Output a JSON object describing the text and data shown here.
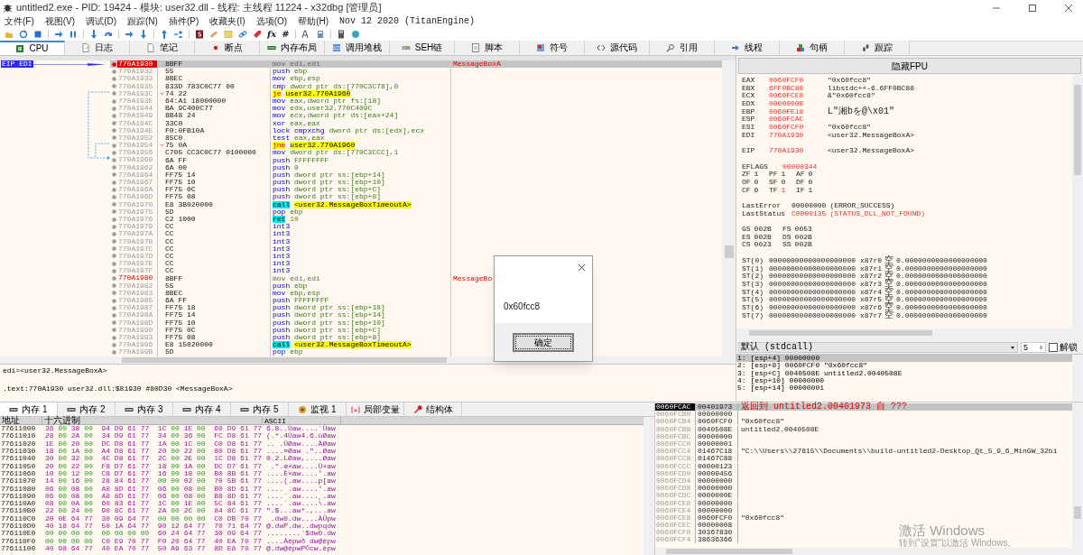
{
  "window": {
    "title": "untitled2.exe - PID: 19424 - 模块: user32.dll - 线程: 主线程 11224 - x32dbg [管理员]"
  },
  "menu": [
    "文件(F)",
    "视图(V)",
    "调试(D)",
    "跟踪(N)",
    "插件(P)",
    "收藏夹(I)",
    "选项(O)",
    "帮助(H)"
  ],
  "build_info": "Nov 12 2020 (TitanEngine)",
  "toolbar_texts": [
    "fx",
    "#"
  ],
  "tabs": [
    {
      "label": "CPU",
      "selected": true
    },
    {
      "label": "日志",
      "selected": false
    },
    {
      "label": "笔记",
      "selected": false
    },
    {
      "label": "断点",
      "selected": false
    },
    {
      "label": "内存布局",
      "selected": false
    },
    {
      "label": "调用堆栈",
      "selected": false
    },
    {
      "label": "SEH链",
      "selected": false
    },
    {
      "label": "脚本",
      "selected": false
    },
    {
      "label": "符号",
      "selected": false
    },
    {
      "label": "源代码",
      "selected": false
    },
    {
      "label": "引用",
      "selected": false
    },
    {
      "label": "线程",
      "selected": false
    },
    {
      "label": "句柄",
      "selected": false
    },
    {
      "label": "跟踪",
      "selected": false
    }
  ],
  "disassembly": {
    "pointer_label": "EIP EDI",
    "rows": [
      {
        "address": "770A1930",
        "bytes": "8BFF",
        "mnemonic": "mov",
        "operands": "edi,edi",
        "comment": "MessageBoxA",
        "eip": true,
        "symbol": true,
        "kind": "nop",
        "branch": false,
        "selected": true
      },
      {
        "address": "770A1932",
        "bytes": "55",
        "mnemonic": "push",
        "operands": "ebp",
        "eip": false,
        "symbol": false,
        "kind": "plain",
        "branch": false,
        "selected": false
      },
      {
        "address": "770A1933",
        "bytes": "8BEC",
        "mnemonic": "mov",
        "operands": "ebp,esp",
        "eip": false,
        "symbol": false,
        "kind": "plain",
        "branch": false,
        "selected": false
      },
      {
        "address": "770A1935",
        "bytes": "833D 783C0C77 00",
        "mnemonic": "cmp",
        "operands": "dword ptr ds:[770C3C78],0",
        "eip": false,
        "symbol": false,
        "kind": "plain",
        "branch": false,
        "selected": false
      },
      {
        "address": "770A193C",
        "bytes": "74 22",
        "mnemonic": "je",
        "operands": "user32.770A1960",
        "eip": false,
        "symbol": false,
        "kind": "jump",
        "branch": true,
        "selected": false
      },
      {
        "address": "770A193E",
        "bytes": "64:A1 18000000",
        "mnemonic": "mov",
        "operands": "eax,dword ptr fs:[18]",
        "eip": false,
        "symbol": false,
        "kind": "plain",
        "branch": false,
        "selected": false
      },
      {
        "address": "770A1944",
        "bytes": "BA 9C400C77",
        "mnemonic": "mov",
        "operands": "edx,user32.770C409C",
        "eip": false,
        "symbol": false,
        "kind": "plain",
        "branch": false,
        "selected": false
      },
      {
        "address": "770A1949",
        "bytes": "8B48 24",
        "mnemonic": "mov",
        "operands": "ecx,dword ptr ds:[eax+24]",
        "eip": false,
        "symbol": false,
        "kind": "plain",
        "branch": false,
        "selected": false
      },
      {
        "address": "770A194C",
        "bytes": "33C0",
        "mnemonic": "xor",
        "operands": "eax,eax",
        "eip": false,
        "symbol": false,
        "kind": "plain",
        "branch": false,
        "selected": false
      },
      {
        "address": "770A194E",
        "bytes": "F0:0FB10A",
        "mnemonic": "lock cmpxchg",
        "operands": "dword ptr ds:[edx],ecx",
        "eip": false,
        "symbol": false,
        "kind": "plain",
        "branch": false,
        "selected": false
      },
      {
        "address": "770A1952",
        "bytes": "85C0",
        "mnemonic": "test",
        "operands": "eax,eax",
        "eip": false,
        "symbol": false,
        "kind": "plain",
        "branch": false,
        "selected": false
      },
      {
        "address": "770A1954",
        "bytes": "75 0A",
        "mnemonic": "jne",
        "operands": "user32.770A1960",
        "eip": false,
        "symbol": false,
        "kind": "jump",
        "branch": true,
        "selected": false
      },
      {
        "address": "770A1956",
        "bytes": "C705 CC3C0C77 0100000",
        "mnemonic": "mov",
        "operands": "dword ptr ds:[770C3CCC],1",
        "eip": false,
        "symbol": false,
        "kind": "plain",
        "branch": false,
        "selected": false
      },
      {
        "address": "770A1960",
        "bytes": "6A FF",
        "mnemonic": "push",
        "operands": "FFFFFFFF",
        "eip": false,
        "symbol": false,
        "kind": "plain",
        "branch": false,
        "selected": false
      },
      {
        "address": "770A1962",
        "bytes": "6A 00",
        "mnemonic": "push",
        "operands": "0",
        "eip": false,
        "symbol": false,
        "kind": "plain",
        "branch": false,
        "selected": false
      },
      {
        "address": "770A1964",
        "bytes": "FF75 14",
        "mnemonic": "push",
        "operands": "dword ptr ss:[ebp+14]",
        "eip": false,
        "symbol": false,
        "kind": "plain",
        "branch": false,
        "selected": false
      },
      {
        "address": "770A1967",
        "bytes": "FF75 10",
        "mnemonic": "push",
        "operands": "dword ptr ss:[ebp+10]",
        "eip": false,
        "symbol": false,
        "kind": "plain",
        "branch": false,
        "selected": false
      },
      {
        "address": "770A196A",
        "bytes": "FF75 0C",
        "mnemonic": "push",
        "operands": "dword ptr ss:[ebp+C]",
        "eip": false,
        "symbol": false,
        "kind": "plain",
        "branch": false,
        "selected": false
      },
      {
        "address": "770A196D",
        "bytes": "FF75 08",
        "mnemonic": "push",
        "operands": "dword ptr ss:[ebp+8]",
        "eip": false,
        "symbol": false,
        "kind": "plain",
        "branch": false,
        "selected": false
      },
      {
        "address": "770A1970",
        "bytes": "E8 3B020000",
        "mnemonic": "call",
        "operands": "<user32.MessageBoxTimeoutA>",
        "eip": false,
        "symbol": false,
        "kind": "call",
        "branch": false,
        "selected": false
      },
      {
        "address": "770A1975",
        "bytes": "5D",
        "mnemonic": "pop",
        "operands": "ebp",
        "eip": false,
        "symbol": false,
        "kind": "plain",
        "branch": false,
        "selected": false
      },
      {
        "address": "770A1976",
        "bytes": "C2 1000",
        "mnemonic": "ret",
        "operands": "10",
        "eip": false,
        "symbol": false,
        "kind": "ret",
        "branch": false,
        "selected": false
      },
      {
        "address": "770A1979",
        "bytes": "CC",
        "mnemonic": "int3",
        "eip": false,
        "symbol": false,
        "kind": "plain",
        "branch": false,
        "selected": false
      },
      {
        "address": "770A197A",
        "bytes": "CC",
        "mnemonic": "int3",
        "eip": false,
        "symbol": false,
        "kind": "plain",
        "branch": false,
        "selected": false
      },
      {
        "address": "770A197B",
        "bytes": "CC",
        "mnemonic": "int3",
        "eip": false,
        "symbol": false,
        "kind": "plain",
        "branch": false,
        "selected": false
      },
      {
        "address": "770A197C",
        "bytes": "CC",
        "mnemonic": "int3",
        "eip": false,
        "symbol": false,
        "kind": "plain",
        "branch": false,
        "selected": false
      },
      {
        "address": "770A197D",
        "bytes": "CC",
        "mnemonic": "int3",
        "eip": false,
        "symbol": false,
        "kind": "plain",
        "branch": false,
        "selected": false
      },
      {
        "address": "770A197E",
        "bytes": "CC",
        "mnemonic": "int3",
        "eip": false,
        "symbol": false,
        "kind": "plain",
        "branch": false,
        "selected": false
      },
      {
        "address": "770A197F",
        "bytes": "CC",
        "mnemonic": "int3",
        "eip": false,
        "symbol": false,
        "kind": "plain",
        "branch": false,
        "selected": false
      },
      {
        "address": "770A1980",
        "bytes": "8BFF",
        "mnemonic": "mov",
        "operands": "edi,edi",
        "comment": "MessageBo",
        "eip": false,
        "symbol": true,
        "kind": "nop",
        "branch": false,
        "selected": false
      },
      {
        "address": "770A1982",
        "bytes": "55",
        "mnemonic": "push",
        "operands": "ebp",
        "eip": false,
        "symbol": false,
        "kind": "plain",
        "branch": false,
        "selected": false
      },
      {
        "address": "770A1983",
        "bytes": "8BEC",
        "mnemonic": "mov",
        "operands": "ebp,esp",
        "eip": false,
        "symbol": false,
        "kind": "plain",
        "branch": false,
        "selected": false
      },
      {
        "address": "770A1985",
        "bytes": "6A FF",
        "mnemonic": "push",
        "operands": "FFFFFFFF",
        "eip": false,
        "symbol": false,
        "kind": "plain",
        "branch": false,
        "selected": false
      },
      {
        "address": "770A1987",
        "bytes": "FF75 18",
        "mnemonic": "push",
        "operands": "dword ptr ss:[ebp+18]",
        "eip": false,
        "symbol": false,
        "kind": "plain",
        "branch": false,
        "selected": false
      },
      {
        "address": "770A198A",
        "bytes": "FF75 14",
        "mnemonic": "push",
        "operands": "dword ptr ss:[ebp+14]",
        "eip": false,
        "symbol": false,
        "kind": "plain",
        "branch": false,
        "selected": false
      },
      {
        "address": "770A198D",
        "bytes": "FF75 10",
        "mnemonic": "push",
        "operands": "dword ptr ss:[ebp+10]",
        "eip": false,
        "symbol": false,
        "kind": "plain",
        "branch": false,
        "selected": false
      },
      {
        "address": "770A1990",
        "bytes": "FF75 0C",
        "mnemonic": "push",
        "operands": "dword ptr ss:[ebp+C]",
        "eip": false,
        "symbol": false,
        "kind": "plain",
        "branch": false,
        "selected": false
      },
      {
        "address": "770A1993",
        "bytes": "FF75 08",
        "mnemonic": "push",
        "operands": "dword ptr ss:[ebp+8]",
        "eip": false,
        "symbol": false,
        "kind": "plain",
        "branch": false,
        "selected": false
      },
      {
        "address": "770A1996",
        "bytes": "E8 15020000",
        "mnemonic": "call",
        "operands": "<user32.MessageBoxTimeoutA>",
        "eip": false,
        "symbol": false,
        "kind": "call",
        "branch": false,
        "selected": false
      },
      {
        "address": "770A199B",
        "bytes": "5D",
        "mnemonic": "pop",
        "operands": "ebp",
        "eip": false,
        "symbol": false,
        "kind": "plain",
        "branch": false,
        "selected": false
      }
    ]
  },
  "registers": {
    "toggle_button": "隐藏FPU",
    "general": [
      {
        "name": "EAX",
        "value": "0060FCF0",
        "comment": "\"0x60fcc8\"",
        "changed": true
      },
      {
        "name": "EBX",
        "value": "6FF0BC88",
        "comment": "libstdc++-6.6FF0BC88",
        "changed": true
      },
      {
        "name": "ECX",
        "value": "0060FCE8",
        "comment": "&\"0x60fcc8\"",
        "changed": true
      },
      {
        "name": "EDX",
        "value": "00000008",
        "changed": true
      },
      {
        "name": "EBP",
        "value": "0060FE18",
        "comment": "L\"湘bを@\\x01\"",
        "changed": true
      },
      {
        "name": "ESP",
        "value": "0060FCAC",
        "changed": true
      },
      {
        "name": "ESI",
        "value": "0060FCF0",
        "comment": "\"0x60fcc8\"",
        "changed": true
      },
      {
        "name": "EDI",
        "value": "770A1930",
        "comment": "<user32.MessageBoxA>",
        "changed": true
      }
    ],
    "eip": {
      "name": "EIP",
      "value": "770A1930",
      "comment": "<user32.MessageBoxA>",
      "changed": true
    },
    "eflags": {
      "name": "EFLAGS",
      "value": "00000344",
      "changed": true
    },
    "flags": [
      [
        {
          "name": "ZF",
          "value": "1",
          "changed": false
        },
        {
          "name": "PF",
          "value": "1",
          "changed": false
        },
        {
          "name": "AF",
          "value": "0",
          "changed": false
        }
      ],
      [
        {
          "name": "OF",
          "value": "0",
          "changed": false
        },
        {
          "name": "SF",
          "value": "0",
          "changed": false
        },
        {
          "name": "DF",
          "value": "0",
          "changed": false
        }
      ],
      [
        {
          "name": "CF",
          "value": "0",
          "changed": false
        },
        {
          "name": "TF",
          "value": "1",
          "changed": true
        },
        {
          "name": "IF",
          "value": "1",
          "changed": false
        }
      ]
    ],
    "errors": [
      {
        "name": "LastError",
        "value": "00000000",
        "detail": "(ERROR_SUCCESS)",
        "changed": false
      },
      {
        "name": "LastStatus",
        "value": "C0000135",
        "detail": "(STATUS_DLL_NOT_FOUND)",
        "changed": true
      }
    ],
    "segments": [
      [
        {
          "name": "GS",
          "value": "002B"
        },
        {
          "name": "FS",
          "value": "0053"
        }
      ],
      [
        {
          "name": "ES",
          "value": "002B"
        },
        {
          "name": "DS",
          "value": "002B"
        }
      ],
      [
        {
          "name": "CS",
          "value": "0023"
        },
        {
          "name": "SS",
          "value": "002B"
        }
      ]
    ],
    "fpu": [
      {
        "name": "ST(0)",
        "value": "00000000000000000000",
        "reg": "x87r0",
        "tag": "空",
        "float": "0.0000000000000000000"
      },
      {
        "name": "ST(1)",
        "value": "00000000000000000000",
        "reg": "x87r1",
        "tag": "空",
        "float": "0.0000000000000000000"
      },
      {
        "name": "ST(2)",
        "value": "00000000000000000000",
        "reg": "x87r2",
        "tag": "空",
        "float": "0.0000000000000000000"
      },
      {
        "name": "ST(3)",
        "value": "00000000000000000000",
        "reg": "x87r3",
        "tag": "空",
        "float": "0.0000000000000000000"
      },
      {
        "name": "ST(4)",
        "value": "00000000000000000000",
        "reg": "x87r4",
        "tag": "空",
        "float": "0.0000000000000000000"
      },
      {
        "name": "ST(5)",
        "value": "00000000000000000000",
        "reg": "x87r5",
        "tag": "空",
        "float": "0.0000000000000000000"
      },
      {
        "name": "ST(6)",
        "value": "00000000000000000000",
        "reg": "x87r6",
        "tag": "空",
        "float": "0.0000000000000000000"
      },
      {
        "name": "ST(7)",
        "value": "00000000000000000000",
        "reg": "x87r7",
        "tag": "空",
        "float": "0.0000000000000000000"
      }
    ]
  },
  "arguments": {
    "convention": "默认 (stdcall)",
    "count": "5",
    "unlock": {
      "label": "解锁",
      "checked": false
    },
    "rows": [
      {
        "text": "1: [esp+4] 00000000",
        "selected": true
      },
      {
        "text": "2: [esp+8] 0060FCF0 \"0x60fcc8\"",
        "selected": false
      },
      {
        "text": "3: [esp+C] 0040508E untitled2.0040508E",
        "selected": false
      },
      {
        "text": "4: [esp+10] 00000000",
        "selected": false
      },
      {
        "text": "5: [esp+14] 00000001",
        "selected": false
      }
    ]
  },
  "info_pane": [
    "edi=<user32.MessageBoxA>",
    ".text:770A1930 user32.dll:$81930 #80D30 <MessageBoxA>"
  ],
  "dump_tabs": [
    {
      "label": "内存 1",
      "selected": true
    },
    {
      "label": "内存 2",
      "selected": false
    },
    {
      "label": "内存 3",
      "selected": false
    },
    {
      "label": "内存 4",
      "selected": false
    },
    {
      "label": "内存 5",
      "selected": false
    },
    {
      "label": "监视 1",
      "selected": false
    },
    {
      "label": "局部变量",
      "selected": false
    },
    {
      "label": "结构体",
      "selected": false
    }
  ],
  "dump": {
    "columns": [
      "地址",
      "十六进制",
      "ASCII"
    ],
    "rows": [
      {
        "address": "77611000",
        "bytes": "36 00 38 00 94 D9 61 77 1C 00 1E 00 60 D9 61 77",
        "ascii": "6.8..Ùaw....`Ùaw"
      },
      {
        "address": "77611010",
        "bytes": "28 00 2A 00 34 D9 61 77 34 00 36 00 FC D8 61 77",
        "ascii": "(.*.4Ùaw4.6.üØaw"
      },
      {
        "address": "77611020",
        "bytes": "1E 00 20 00 DC D8 61 77 1A 00 1C 00 C0 D8 61 77",
        "ascii": ".. .ÜØaw....ÀØaw"
      },
      {
        "address": "77611030",
        "bytes": "18 00 1A 00 A4 D8 61 77 20 00 22 00 80 D8 61 77",
        "ascii": "....¤Øaw .\"..Øaw"
      },
      {
        "address": "77611040",
        "bytes": "30 00 32 00 4C D8 61 77 2C 00 2E 00 1C D8 61 77",
        "ascii": "0.2.LØaw,....Øaw"
      },
      {
        "address": "77611050",
        "bytes": "20 00 22 00 F8 D7 61 77 18 00 1A 00 DC D7 61 77",
        "ascii": " .\".ø×aw....Ü×aw"
      },
      {
        "address": "77611060",
        "bytes": "10 00 12 00 C8 D7 61 77 16 00 18 00 B0 8B 61 77",
        "ascii": "....È×aw....°.aw"
      },
      {
        "address": "77611070",
        "bytes": "14 00 16 00 28 84 61 77 00 00 02 00 70 5B 61 77",
        "ascii": "....(.aw....p[aw"
      },
      {
        "address": "77611080",
        "bytes": "06 00 08 00 A0 8D 61 77 06 00 08 00 B0 8D 61 77",
        "ascii": ".... .aw....°.aw"
      },
      {
        "address": "77611090",
        "bytes": "06 00 08 00 A8 8D 61 77 06 00 08 00 B8 8D 61 77",
        "ascii": "....¨.aw....¸.aw"
      },
      {
        "address": "776110A0",
        "bytes": "08 00 0A 00 60 83 61 77 1C 00 1E 00 5C 84 61 77",
        "ascii": "....`.aw....\\.aw"
      },
      {
        "address": "776110B0",
        "bytes": "22 00 24 00 90 8C 61 77 2A 00 2C 00 84 8C 61 77",
        "ascii": "\".$...aw*.,...aw"
      },
      {
        "address": "776110C0",
        "bytes": "20 0E 64 77 30 09 64 77 00 00 00 00 C0 DB 70 77",
        "ascii": " .dw0.dw....ÀÛpw"
      },
      {
        "address": "776110D0",
        "bytes": "40 18 64 77 50 1A 64 77 90 12 64 77 70 71 64 77",
        "ascii": "@.dwP.dw..dwpqdw"
      },
      {
        "address": "776110E0",
        "bytes": "00 00 00 00 00 00 00 00 60 24 64 77 30 09 64 77",
        "ascii": "........`$dw0.dw"
      },
      {
        "address": "776110F0",
        "bytes": "00 00 00 00 C0 E9 70 77 F0 20 64 77 40 EA 70 77",
        "ascii": "....Àépwð dw@êpw"
      },
      {
        "address": "77611100",
        "bytes": "40 98 64 77 40 EA 70 77 50 A9 63 77 8D E8 70 77",
        "ascii": "@.dw@êpwP©cw.èpw"
      }
    ]
  },
  "stack": {
    "rows": [
      {
        "address": "0060FCAC",
        "value": "00401973",
        "comment": "返回到 untitled2.00401973 自 ???",
        "selected": true
      },
      {
        "address": "0060FCB0",
        "value": "00000000",
        "selected": false
      },
      {
        "address": "0060FCB4",
        "value": "0060FCF0",
        "comment": "\"0x60fcc8\"",
        "selected": false
      },
      {
        "address": "0060FCB8",
        "value": "0040508E",
        "comment": "untitled2.0040508E",
        "selected": false
      },
      {
        "address": "0060FCBC",
        "value": "00000000",
        "selected": false
      },
      {
        "address": "0060FCC0",
        "value": "00000001",
        "selected": false
      },
      {
        "address": "0060FCC4",
        "value": "01467C18",
        "comment": "\"C:\\\\Users\\\\27815\\\\Documents\\\\build-untitled2-Desktop_Qt_5_9_6_MinGW_32bi",
        "selected": false
      },
      {
        "address": "0060FCC8",
        "value": "01467C88",
        "selected": false
      },
      {
        "address": "0060FCCC",
        "value": "00000123",
        "selected": false
      },
      {
        "address": "0060FCD0",
        "value": "00000456",
        "selected": false
      },
      {
        "address": "0060FCD4",
        "value": "00000000",
        "selected": false
      },
      {
        "address": "0060FCD8",
        "value": "00000000",
        "selected": false
      },
      {
        "address": "0060FCDC",
        "value": "0000000E",
        "selected": false
      },
      {
        "address": "0060FCE0",
        "value": "00000000",
        "selected": false
      },
      {
        "address": "0060FCE4",
        "value": "00000000",
        "selected": false
      },
      {
        "address": "0060FCE8",
        "value": "0060FCF0",
        "comment": "\"0x60fcc8\"",
        "selected": false
      },
      {
        "address": "0060FCEC",
        "value": "00000008",
        "selected": false
      },
      {
        "address": "0060FCF0",
        "value": "30367830",
        "selected": false
      },
      {
        "address": "0060FCF4",
        "value": "38636366",
        "selected": false
      }
    ]
  },
  "message_box": {
    "message": "0x60fcc8",
    "button": "确定"
  },
  "activation_notice": {
    "title": "激活 Windows",
    "hint": "转到\"设置\"以激活 Windows。"
  }
}
